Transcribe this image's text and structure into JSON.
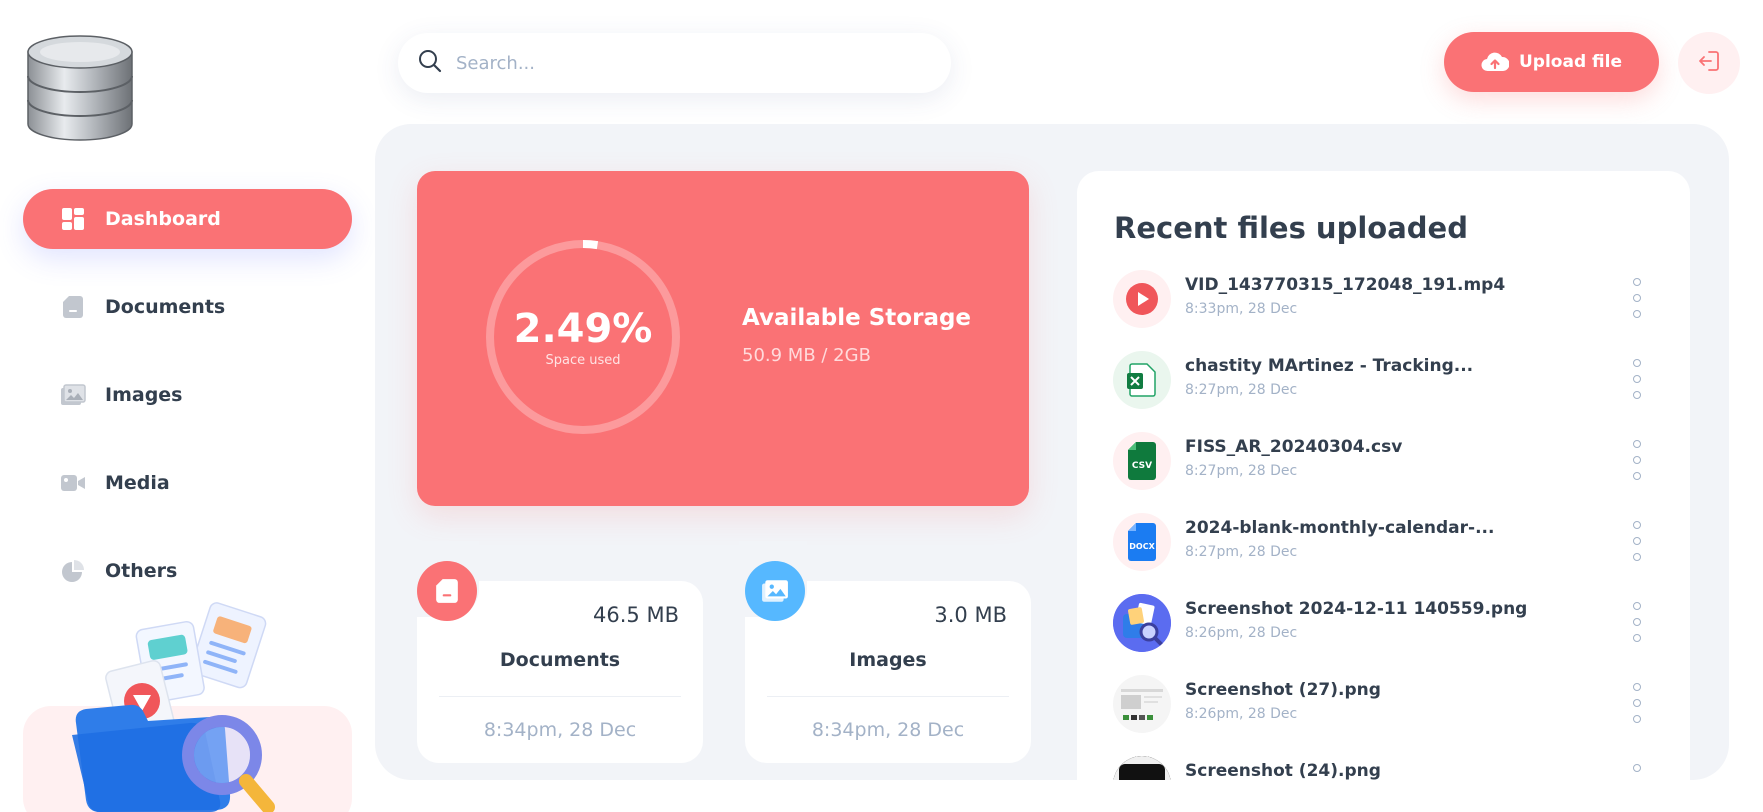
{
  "sidebar": {
    "items": [
      {
        "label": "Dashboard",
        "icon": "dashboard-icon",
        "active": true
      },
      {
        "label": "Documents",
        "icon": "document-icon",
        "active": false
      },
      {
        "label": "Images",
        "icon": "image-icon",
        "active": false
      },
      {
        "label": "Media",
        "icon": "video-camera-icon",
        "active": false
      },
      {
        "label": "Others",
        "icon": "pie-chart-icon",
        "active": false
      }
    ]
  },
  "header": {
    "search_placeholder": "Search...",
    "upload_label": "Upload file"
  },
  "storage": {
    "percent_label": "2.49%",
    "percent_value": 0.0249,
    "caption": "Space used",
    "title": "Available Storage",
    "size": "50.9 MB / 2GB"
  },
  "summary_cards": [
    {
      "name": "Documents",
      "size": "46.5 MB",
      "date": "8:34pm, 28 Dec",
      "icon": "document-icon",
      "color": "#fa7275"
    },
    {
      "name": "Images",
      "size": "3.0 MB",
      "date": "8:34pm, 28 Dec",
      "icon": "image-icon",
      "color": "#56b8ff"
    }
  ],
  "recent": {
    "title": "Recent files uploaded",
    "files": [
      {
        "name": "VID_143770315_172048_191.mp4",
        "date": "8:33pm, 28 Dec",
        "icon": "play-icon"
      },
      {
        "name": "chastity MArtinez - Tracking...",
        "date": "8:27pm, 28 Dec",
        "icon": "excel-icon"
      },
      {
        "name": "FISS_AR_20240304.csv",
        "date": "8:27pm, 28 Dec",
        "icon": "csv-icon",
        "badge": "CSV"
      },
      {
        "name": "2024-blank-monthly-calendar-...",
        "date": "8:27pm, 28 Dec",
        "icon": "docx-icon",
        "badge": "DOCX"
      },
      {
        "name": "Screenshot 2024-12-11 140559.png",
        "date": "8:26pm, 28 Dec",
        "icon": "image-search-icon"
      },
      {
        "name": "Screenshot (27).png",
        "date": "8:26pm, 28 Dec",
        "icon": "screenshot-thumbnail"
      },
      {
        "name": "Screenshot (24).png",
        "date": "",
        "icon": "screenshot-thumbnail"
      }
    ]
  },
  "colors": {
    "brand": "#fa7275",
    "image_accent": "#56b8ff",
    "text": "#333f4e",
    "muted": "#a3b2c7"
  }
}
